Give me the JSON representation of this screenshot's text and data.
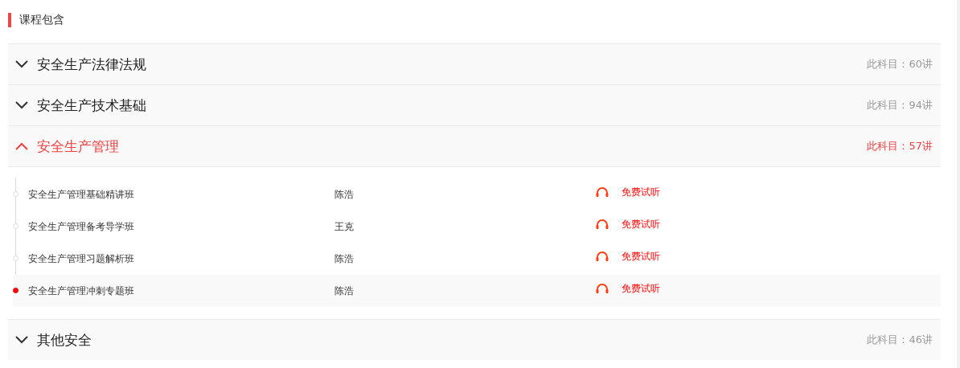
{
  "title": "课程包含",
  "subjects": [
    {
      "name": "安全生产法律法规",
      "count": "此科目：60讲",
      "expanded": false
    },
    {
      "name": "安全生产技术基础",
      "count": "此科目：94讲",
      "expanded": false
    },
    {
      "name": "安全生产管理",
      "count": "此科目：57讲",
      "expanded": true,
      "lessons": [
        {
          "name": "安全生产管理基础精讲班",
          "teacher": "陈浩",
          "action": "免费试听",
          "selected": false
        },
        {
          "name": "安全生产管理备考导学班",
          "teacher": "王克",
          "action": "免费试听",
          "selected": false
        },
        {
          "name": "安全生产管理习题解析班",
          "teacher": "陈浩",
          "action": "免费试听",
          "selected": false
        },
        {
          "name": "安全生产管理冲刺专题班",
          "teacher": "陈浩",
          "action": "免费试听",
          "selected": true
        }
      ]
    },
    {
      "name": "其他安全",
      "count": "此科目：46讲",
      "expanded": false
    }
  ]
}
